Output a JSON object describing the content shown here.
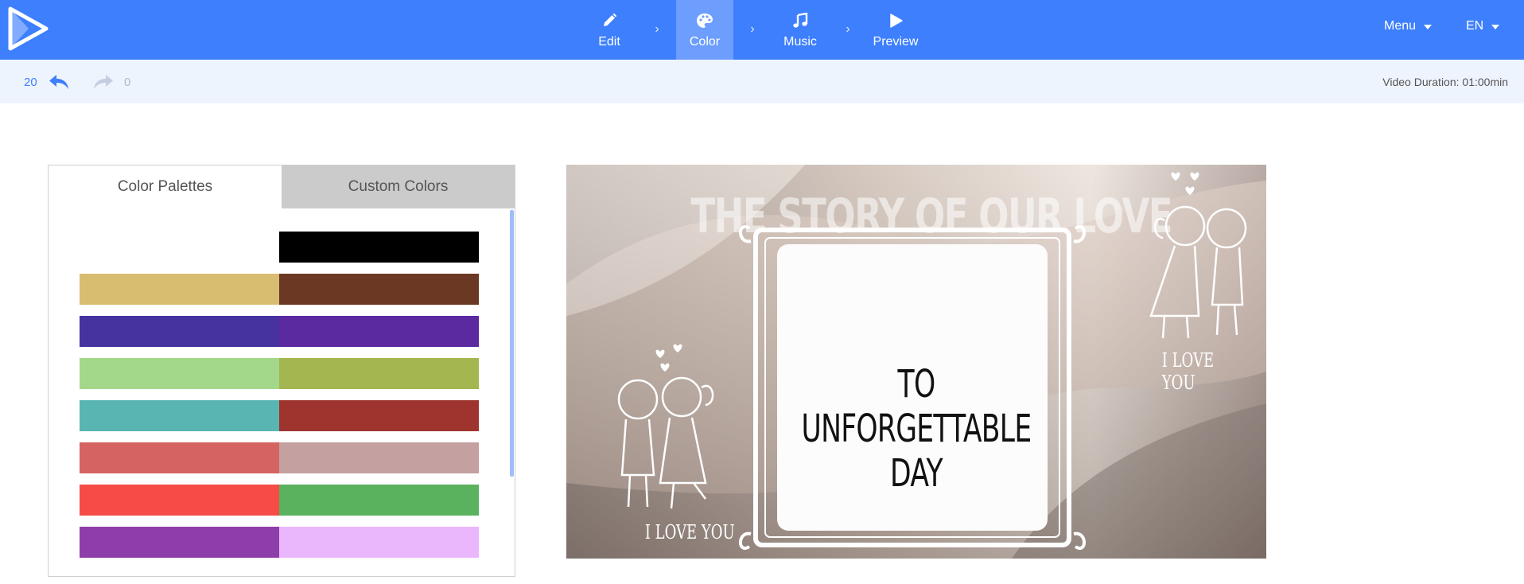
{
  "topbar": {
    "logo_icon": "play-triangle-logo-icon",
    "steps": [
      {
        "label": "Edit",
        "icon": "pencil-icon",
        "active": false
      },
      {
        "label": "Color",
        "icon": "palette-icon",
        "active": true
      },
      {
        "label": "Music",
        "icon": "music-note-icon",
        "active": false
      },
      {
        "label": "Preview",
        "icon": "play-icon",
        "active": false
      }
    ],
    "separator": "›",
    "menu_label": "Menu",
    "language_label": "EN",
    "bg_color": "#3d7ffd",
    "active_step_color": "#6d9efd"
  },
  "history": {
    "undo_count": "20",
    "redo_count": "0",
    "duration_text": "Video Duration: 01:00min"
  },
  "panel": {
    "tabs": [
      {
        "label": "Color Palettes",
        "active": true
      },
      {
        "label": "Custom Colors",
        "active": false
      }
    ],
    "palettes": [
      {
        "left": "#ffffff",
        "right": "#000000"
      },
      {
        "left": "#d8bd71",
        "right": "#6b3823"
      },
      {
        "left": "#4633a0",
        "right": "#5b29a0"
      },
      {
        "left": "#a3d88b",
        "right": "#a3b650"
      },
      {
        "left": "#58b5b2",
        "right": "#9f342f"
      },
      {
        "left": "#d56361",
        "right": "#c4a0a1"
      },
      {
        "left": "#f54c48",
        "right": "#5bb25e"
      },
      {
        "left": "#8e3ea9",
        "right": "#ebb7fc"
      }
    ]
  },
  "preview": {
    "title": "THE STORY OF OUR LOVE",
    "caption": "TO UNFORGETTABLE DAY",
    "love_left": "I LOVE YOU",
    "love_right": "I LOVE YOU"
  }
}
